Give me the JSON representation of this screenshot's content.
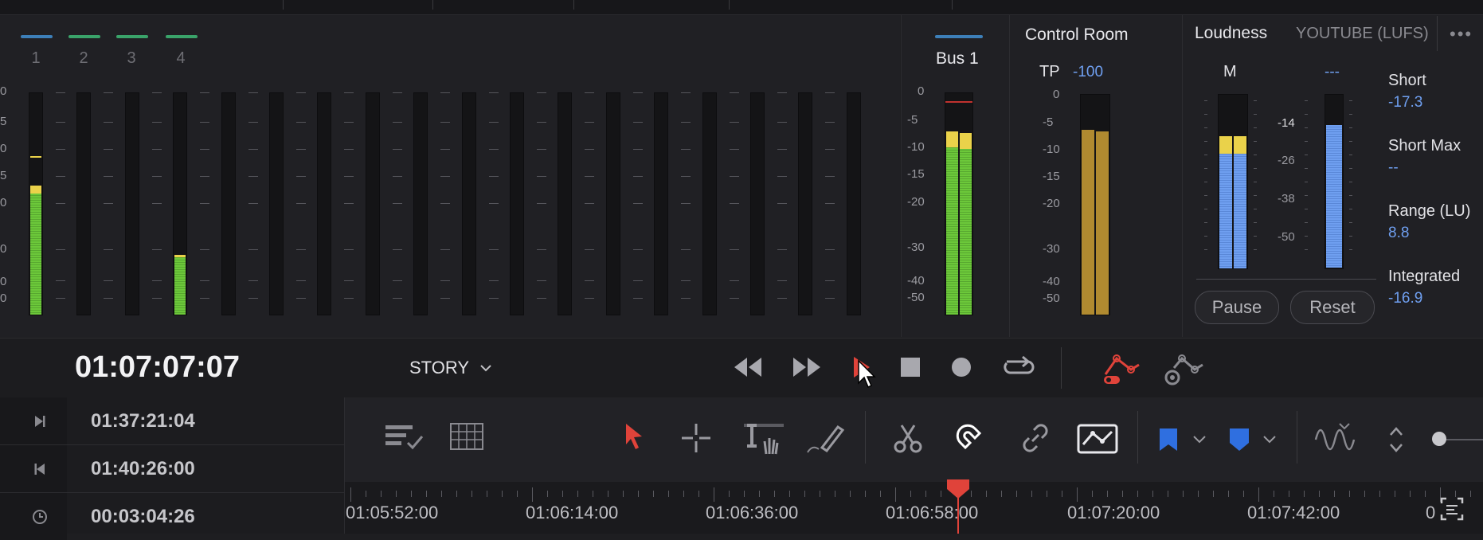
{
  "mixer": {
    "channels": [
      {
        "label": "1",
        "color": "#3d7fb8"
      },
      {
        "label": "2",
        "color": "#3aa36a"
      },
      {
        "label": "3",
        "color": "#3aa36a"
      },
      {
        "label": "4",
        "color": "#3aa36a"
      }
    ],
    "scale_labels": [
      "0",
      "5",
      "0",
      "5",
      "0",
      "0",
      "0",
      "0"
    ]
  },
  "bus": {
    "title": "Bus 1",
    "color": "#3d7fb8",
    "scale_labels": [
      "0",
      "-5",
      "-10",
      "-15",
      "-20",
      "-30",
      "-40",
      "-50"
    ]
  },
  "control_room": {
    "title": "Control Room",
    "tp_label": "TP",
    "tp_value": "-100",
    "scale_labels": [
      "0",
      "-5",
      "-10",
      "-15",
      "-20",
      "-30",
      "-40",
      "-50"
    ]
  },
  "loudness": {
    "title": "Loudness",
    "standard": "YOUTUBE (LUFS)",
    "m_label": "M",
    "m_value": "---",
    "scale_labels": [
      "-14",
      "-26",
      "-38",
      "-50"
    ],
    "stats": [
      {
        "label": "Short",
        "value": "-17.3"
      },
      {
        "label": "Short Max",
        "value": "--"
      },
      {
        "label": "Range (LU)",
        "value": "8.8"
      },
      {
        "label": "Integrated",
        "value": "-16.9"
      }
    ],
    "pause_label": "Pause",
    "reset_label": "Reset"
  },
  "transport": {
    "timecode": "01:07:07:07",
    "timeline_name": "STORY"
  },
  "timecodes": {
    "out_point": "01:37:21:04",
    "in_point": "01:40:26:00",
    "duration": "00:03:04:26"
  },
  "ruler": {
    "labels": [
      "01:05:52:00",
      "01:06:14:00",
      "01:06:36:00",
      "01:06:58:00",
      "01:07:20:00",
      "01:07:42:00",
      "0"
    ]
  },
  "colors": {
    "accent_red": "#e0433a",
    "flag_blue": "#2f6fe0"
  }
}
